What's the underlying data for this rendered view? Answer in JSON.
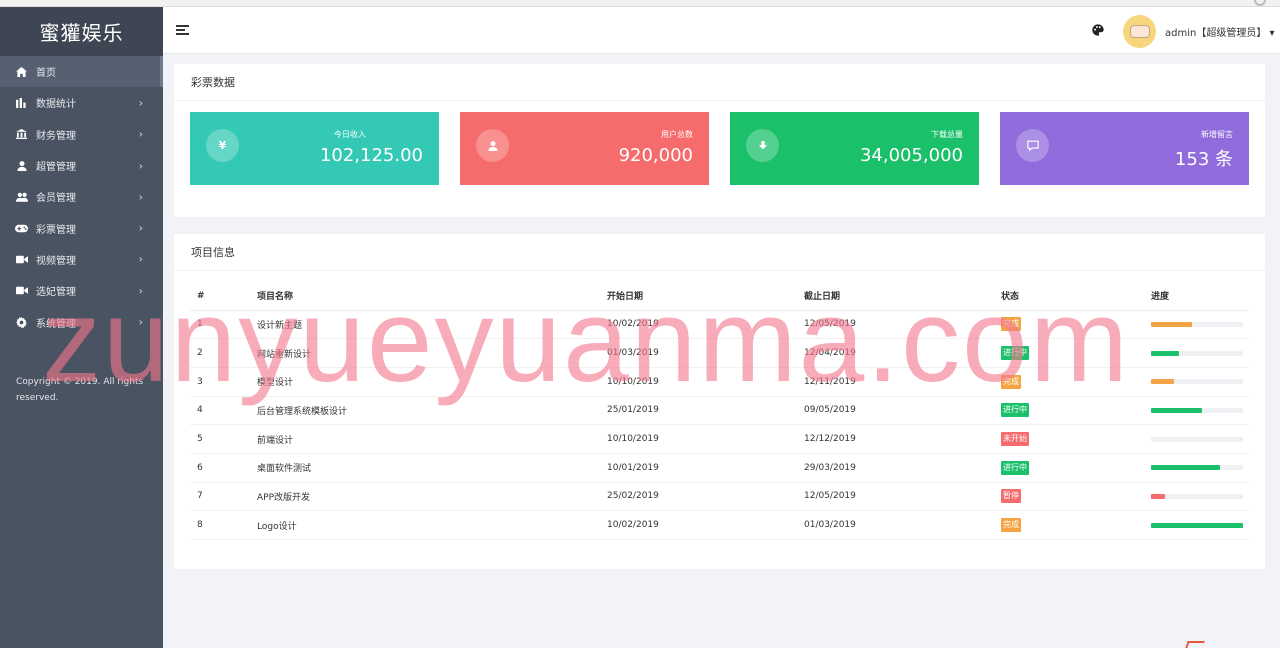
{
  "brand": "蜜獾娱乐",
  "sidebar": {
    "items": [
      {
        "label": "首页",
        "icon": "home-icon",
        "active": true
      },
      {
        "label": "数据统计",
        "icon": "bar-chart-icon"
      },
      {
        "label": "财务管理",
        "icon": "bank-icon"
      },
      {
        "label": "超管管理",
        "icon": "user-icon"
      },
      {
        "label": "会员管理",
        "icon": "users-icon"
      },
      {
        "label": "彩票管理",
        "icon": "gamepad-icon"
      },
      {
        "label": "视频管理",
        "icon": "video-camera-icon"
      },
      {
        "label": "选妃管理",
        "icon": "video-camera-icon"
      },
      {
        "label": "系统管理",
        "icon": "gear-icon"
      }
    ],
    "copyright": "Copyright © 2019. All rights reserved."
  },
  "header": {
    "user": "admin【超级管理员】"
  },
  "lottery_panel": {
    "title": "彩票数据",
    "cards": [
      {
        "label": "今日收入",
        "value": "102,125.00",
        "icon": "yen-icon",
        "color": "#33c9b5"
      },
      {
        "label": "用户总数",
        "value": "920,000",
        "icon": "user-icon",
        "color": "#f66b6b"
      },
      {
        "label": "下载总量",
        "value": "34,005,000",
        "icon": "download-icon",
        "color": "#1bc06b"
      },
      {
        "label": "新增留言",
        "value": "153 条",
        "icon": "message-icon",
        "color": "#8f6bdc"
      }
    ]
  },
  "project_panel": {
    "title": "项目信息",
    "columns": [
      "#",
      "项目名称",
      "开始日期",
      "截止日期",
      "状态",
      "进度"
    ],
    "rows": [
      {
        "idx": "1",
        "name": "设计新主题",
        "start": "10/02/2019",
        "end": "12/05/2019",
        "status": "完成",
        "status_color": "#f4a444",
        "progress": 0.45,
        "bar_color": "#f4a444"
      },
      {
        "idx": "2",
        "name": "网站重新设计",
        "start": "01/03/2019",
        "end": "12/04/2019",
        "status": "进行中",
        "status_color": "#1bc06b",
        "progress": 0.3,
        "bar_color": "#1bc06b"
      },
      {
        "idx": "3",
        "name": "模型设计",
        "start": "10/10/2019",
        "end": "12/11/2019",
        "status": "完成",
        "status_color": "#f4a444",
        "progress": 0.25,
        "bar_color": "#f4a444"
      },
      {
        "idx": "4",
        "name": "后台管理系统模板设计",
        "start": "25/01/2019",
        "end": "09/05/2019",
        "status": "进行中",
        "status_color": "#1bc06b",
        "progress": 0.55,
        "bar_color": "#1bc06b"
      },
      {
        "idx": "5",
        "name": "前端设计",
        "start": "10/10/2019",
        "end": "12/12/2019",
        "status": "未开始",
        "status_color": "#f66b6b",
        "progress": 0.0,
        "bar_color": "#f66b6b"
      },
      {
        "idx": "6",
        "name": "桌面软件测试",
        "start": "10/01/2019",
        "end": "29/03/2019",
        "status": "进行中",
        "status_color": "#1bc06b",
        "progress": 0.75,
        "bar_color": "#1bc06b"
      },
      {
        "idx": "7",
        "name": "APP改版开发",
        "start": "25/02/2019",
        "end": "12/05/2019",
        "status": "暂停",
        "status_color": "#f66b6b",
        "progress": 0.15,
        "bar_color": "#f66b6b"
      },
      {
        "idx": "8",
        "name": "Logo设计",
        "start": "10/02/2019",
        "end": "01/03/2019",
        "status": "完成",
        "status_color": "#f4a444",
        "progress": 1.0,
        "bar_color": "#1bc06b"
      }
    ]
  },
  "watermark": "zunyueyuanma.com"
}
